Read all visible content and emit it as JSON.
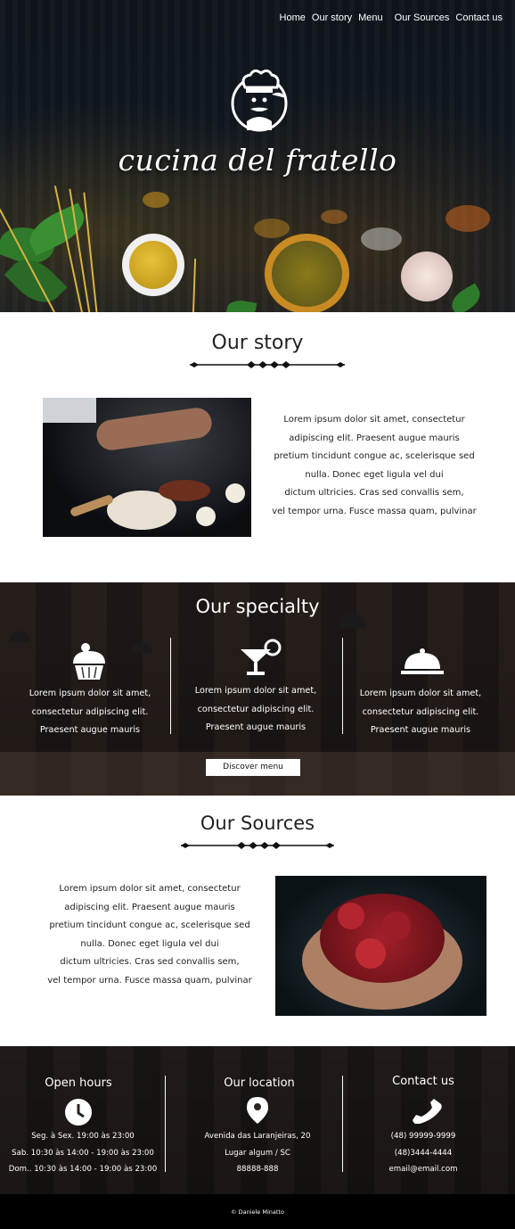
{
  "nav": {
    "items": [
      "Home",
      "Our story",
      "Menu",
      "Our Sources",
      "Contact us"
    ]
  },
  "hero": {
    "brand": "cucina del fratello"
  },
  "story": {
    "title": "Our story",
    "text": [
      "Lorem ipsum dolor sit amet, consectetur",
      "adipiscing elit. Praesent augue mauris",
      "pretium tincidunt congue ac, scelerisque sed",
      "nulla. Donec eget ligula vel dui",
      "dictum ultricies. Cras sed convallis sem,",
      "vel tempor urna. Fusce massa quam,  pulvinar"
    ]
  },
  "specialty": {
    "title": "Our specialty",
    "columns": [
      {
        "icon": "cupcake-icon",
        "lines": [
          "Lorem ipsum dolor sit amet,",
          "consectetur adipiscing elit.",
          "Praesent augue mauris"
        ]
      },
      {
        "icon": "cocktail-icon",
        "lines": [
          "Lorem ipsum dolor sit amet,",
          "consectetur adipiscing elit.",
          "Praesent augue mauris"
        ]
      },
      {
        "icon": "cloche-icon",
        "lines": [
          "Lorem ipsum dolor sit amet,",
          "consectetur adipiscing elit.",
          "Praesent augue mauris"
        ]
      }
    ],
    "button": "Discover menu"
  },
  "sources": {
    "title": "Our Sources",
    "text": [
      "Lorem ipsum dolor sit amet, consectetur",
      "adipiscing elit. Praesent augue mauris",
      "pretium tincidunt congue ac, scelerisque sed",
      "nulla. Donec eget ligula vel dui",
      "dictum ultricies. Cras sed convallis sem,",
      "vel tempor urna. Fusce massa quam,  pulvinar"
    ]
  },
  "info": {
    "hours": {
      "title": "Open hours",
      "icon": "clock-icon",
      "lines": [
        "Seg. à Sex. 19:00 às 23:00",
        "Sab. 10:30 às 14:00 - 19:00 às 23:00",
        "Dom.. 10:30 às 14:00 - 19:00 às 23:00"
      ]
    },
    "location": {
      "title": "Our location",
      "icon": "map-pin-icon",
      "lines": [
        "Avenida das Laranjeiras, 20",
        "Lugar algum / SC",
        "88888-888"
      ]
    },
    "contact": {
      "title": "Contact us",
      "icon": "phone-icon",
      "lines": [
        "(48) 99999-9999",
        "(48)3444-4444",
        "email@email.com"
      ]
    }
  },
  "footer": {
    "credit": "© Daniele Minatto"
  }
}
